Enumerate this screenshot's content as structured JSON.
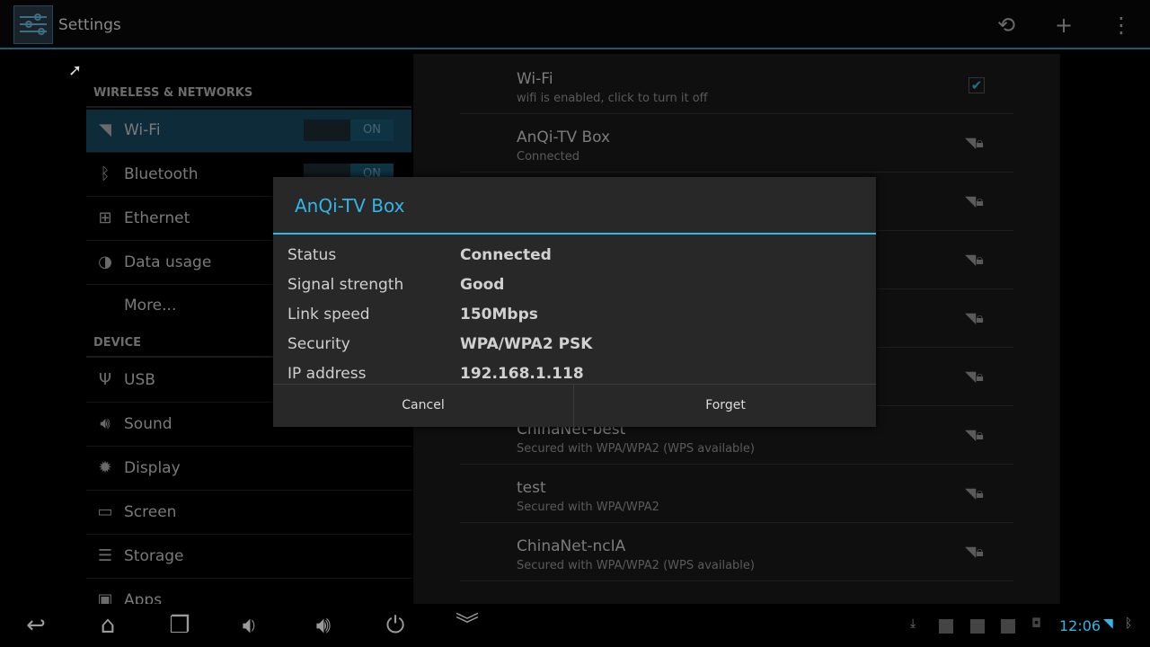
{
  "app": {
    "title": "Settings"
  },
  "toolbar": {
    "icons": [
      "sync-icon",
      "add-icon",
      "overflow-menu-icon"
    ]
  },
  "sidebar": {
    "sections": [
      {
        "label": "WIRELESS & NETWORKS"
      },
      {
        "label": "DEVICE"
      }
    ],
    "items": [
      {
        "label": "Wi-Fi",
        "icon": "wifi-icon",
        "toggle": "ON",
        "selected": true
      },
      {
        "label": "Bluetooth",
        "icon": "bluetooth-icon",
        "toggle": "ON"
      },
      {
        "label": "Ethernet",
        "icon": "ethernet-icon"
      },
      {
        "label": "Data usage",
        "icon": "data-usage-icon"
      },
      {
        "label": "More..."
      },
      {
        "label": "USB",
        "icon": "usb-icon"
      },
      {
        "label": "Sound",
        "icon": "sound-icon"
      },
      {
        "label": "Display",
        "icon": "display-icon"
      },
      {
        "label": "Screen",
        "icon": "screen-icon"
      },
      {
        "label": "Storage",
        "icon": "storage-icon"
      },
      {
        "label": "Apps",
        "icon": "apps-icon"
      }
    ]
  },
  "wifi_list": {
    "header": {
      "title": "Wi-Fi",
      "subtitle": "wifi is enabled, click to turn it off",
      "checked": true
    },
    "networks": [
      {
        "name": "AnQi-TV Box",
        "status": "Connected"
      },
      {
        "name": "ChinaNet-best",
        "status": "Secured with WPA/WPA2 (WPS available)"
      },
      {
        "name": "test",
        "status": "Secured with WPA/WPA2"
      },
      {
        "name": "ChinaNet-ncIA",
        "status": "Secured with WPA/WPA2 (WPS available)"
      }
    ]
  },
  "dialog": {
    "title": "AnQi-TV Box",
    "fields": [
      {
        "key": "Status",
        "value": "Connected"
      },
      {
        "key": "Signal strength",
        "value": "Good"
      },
      {
        "key": "Link speed",
        "value": "150Mbps"
      },
      {
        "key": "Security",
        "value": "WPA/WPA2 PSK"
      },
      {
        "key": "IP address",
        "value": "192.168.1.118"
      }
    ],
    "cancel": "Cancel",
    "forget": "Forget"
  },
  "statusbar": {
    "time": "12:06",
    "accent": "#33b5e5"
  },
  "colors": {
    "accent": "#33b5e5"
  }
}
